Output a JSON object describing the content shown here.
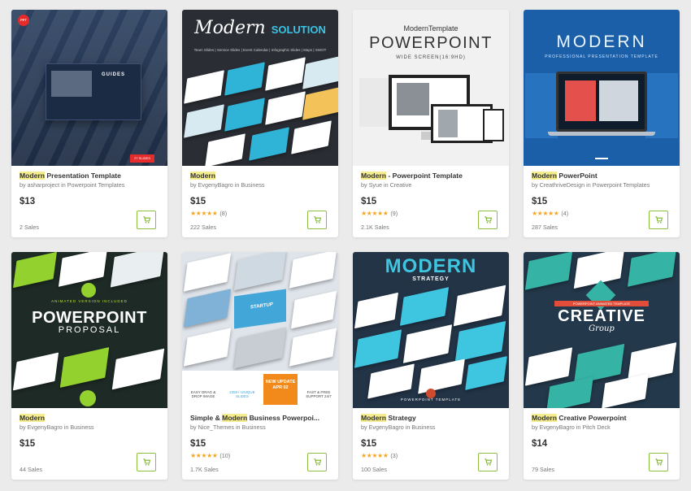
{
  "colors": {
    "highlight": "#f4ec8e",
    "star": "#f5a623",
    "cart_border": "#8cbf3f",
    "cart_icon": "#7cb32f"
  },
  "cards": [
    {
      "title_hl": "Modern",
      "title_rest": " Presentation Template",
      "author": "asharproject",
      "category": "Powerpoint Templates",
      "price": "$13",
      "stars": "",
      "reviews": "",
      "sales": "2 Sales",
      "thumb": {
        "badge": "PPT",
        "label": "GUIDES",
        "tag": "27 SLIDES"
      }
    },
    {
      "title_hl": "Modern",
      "title_rest": "",
      "author": "EvgenyBagro",
      "category": "Business",
      "price": "$15",
      "stars": "★★★★★",
      "reviews": "(8)",
      "sales": "222 Sales",
      "thumb": {
        "script": "Modern",
        "word": "SOLUTION",
        "sub": "Team Slides | Service Slides | Event Calendar | Infographic Slides | Maps | SWOT"
      }
    },
    {
      "title_hl": "Modern",
      "title_rest": " - Powerpoint Template",
      "author": "Syue",
      "category": "Creative",
      "price": "$15",
      "stars": "★★★★★",
      "reviews": "(9)",
      "sales": "2.1K Sales",
      "thumb": {
        "line1": "ModernTemplate",
        "line2": "POWERPOINT",
        "line3": "WIDE SCREEN(16:9HD)"
      }
    },
    {
      "title_hl": "Modern",
      "title_rest": " PowerPoint",
      "author": "CreathriveDesign",
      "category": "Powerpoint Templates",
      "price": "$15",
      "stars": "★★★★★",
      "reviews": "(4)",
      "sales": "287 Sales",
      "thumb": {
        "line1": "MODERN",
        "line2": "PROFESSIONAL PRESENTATION TEMPLATE"
      }
    },
    {
      "title_hl": "Modern",
      "title_rest": "",
      "author": "EvgenyBagro",
      "category": "Business",
      "price": "$15",
      "stars": "",
      "reviews": "",
      "sales": "44 Sales",
      "thumb": {
        "line0": "ANIMATED VERSION INCLUDED",
        "line1": "POWERPOINT",
        "line2": "PROPOSAL"
      }
    },
    {
      "title_hl": "Modern",
      "title_pre": "Simple & ",
      "title_rest": " Business Powerpoi...",
      "author": "Nice_Themes",
      "category": "Business",
      "price": "$15",
      "stars": "★★★★★",
      "reviews": "(10)",
      "sales": "1.7K Sales",
      "thumb": {
        "startup": "STARTUP",
        "c1": "EASY DRAG & DROP IMAGE",
        "c2": "2350+ UNIQUE SLIDES",
        "c3": "NEW UPDATE APR 02",
        "c4": "FAST & FREE SUPPORT 24/7"
      }
    },
    {
      "title_hl": "Modern",
      "title_rest": " Strategy",
      "author": "EvgenyBagro",
      "category": "Business",
      "price": "$15",
      "stars": "★★★★★",
      "reviews": "(3)",
      "sales": "100 Sales",
      "thumb": {
        "line1": "MODERN",
        "line2": "STRATEGY",
        "foot": "POWERPOINT TEMPLATE"
      }
    },
    {
      "title_hl": "Modern",
      "title_rest": " Creative Powerpoint",
      "author": "EvgenyBagro",
      "category": "Pitch Deck",
      "price": "$14",
      "stars": "",
      "reviews": "",
      "sales": "79 Sales",
      "thumb": {
        "line0": "POWERPOINT ANIMATED TEMPLATE",
        "line1": "CREATIVE",
        "line2": "Group"
      }
    }
  ],
  "labels": {
    "by": "by",
    "in": "in"
  }
}
